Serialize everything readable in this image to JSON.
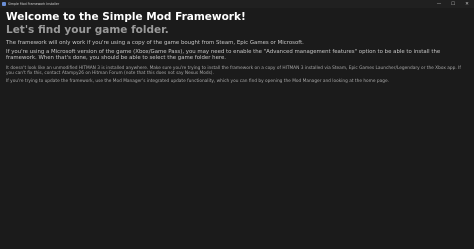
{
  "window": {
    "title": "Simple Mod Framework Installer",
    "minimize_glyph": "—",
    "maximize_glyph": "☐",
    "close_glyph": "✕"
  },
  "main": {
    "heading": "Welcome to the Simple Mod Framework!",
    "subheading": "Let's find your game folder.",
    "paragraph_1": "The framework will only work if you're using a copy of the game bought from Steam, Epic Games or Microsoft.",
    "paragraph_2": "If you're using a Microsoft version of the game (Xbox/Game Pass), you may need to enable the \"Advanced management features\" option to be able to install the framework. When that's done, you should be able to select the game folder here.",
    "paragraph_3": "It doesn't look like an unmodified HITMAN 3 is installed anywhere. Make sure you're trying to install the framework on a copy of HITMAN 3 installed via Steam, Epic Games Launcher/Legendary or the Xbox app. If you can't fix this, contact Atampy26 on Hitman Forum (note that this does not say Nexus Mods).",
    "paragraph_4": "If you're trying to update the framework, use the Mod Manager's integrated update functionality, which you can find by opening the Mod Manager and looking at the home page."
  },
  "colors": {
    "background": "#1b1b1b",
    "titlebar": "#202020",
    "heading": "#ffffff",
    "subheading": "#9a9a9a",
    "body_text": "#c8c8c8",
    "secondary_text": "#a7a7a7"
  }
}
